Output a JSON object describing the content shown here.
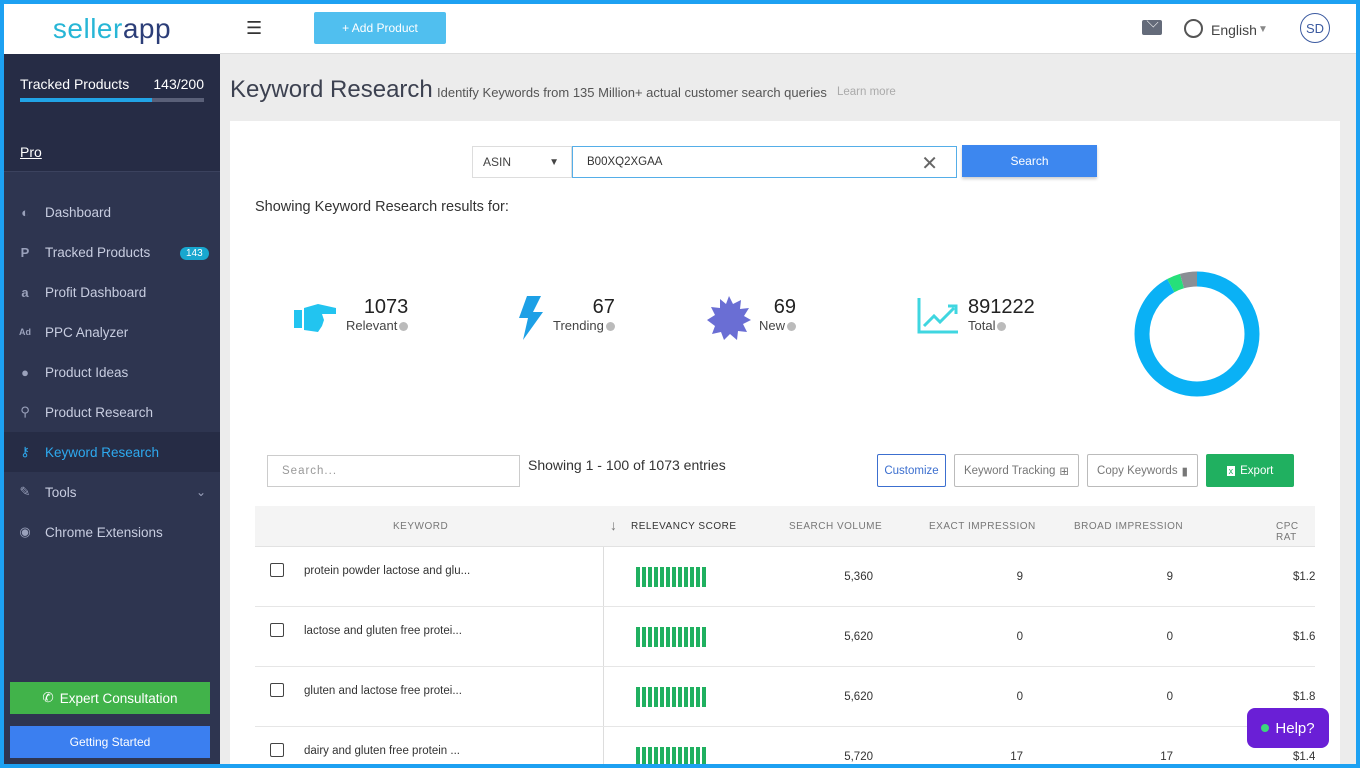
{
  "brand": {
    "part1": "seller",
    "part2": "app"
  },
  "sidebar": {
    "tracked_label": "Tracked Products",
    "tracked_count": "143/200",
    "tracked_fraction": 0.715,
    "plan": "Pro",
    "items": [
      {
        "label": "Dashboard",
        "icon": "speedometer-icon",
        "glyph": "◐"
      },
      {
        "label": "Tracked Products",
        "icon": "p-circle-icon",
        "glyph": "P",
        "badge": "143"
      },
      {
        "label": "Profit Dashboard",
        "icon": "amazon-icon",
        "glyph": "a"
      },
      {
        "label": "PPC Analyzer",
        "icon": "ad-icon",
        "glyph": "Ad"
      },
      {
        "label": "Product Ideas",
        "icon": "lightbulb-icon",
        "glyph": "●"
      },
      {
        "label": "Product Research",
        "icon": "search-icon",
        "glyph": "⚲"
      },
      {
        "label": "Keyword Research",
        "icon": "key-icon",
        "glyph": "⚷",
        "active": true
      },
      {
        "label": "Tools",
        "icon": "wrench-icon",
        "glyph": "✎"
      },
      {
        "label": "Chrome Extensions",
        "icon": "chrome-icon",
        "glyph": "◉"
      }
    ],
    "expert": "Expert Consultation",
    "getting_started": "Getting Started"
  },
  "topbar": {
    "add_product": "+ Add Product",
    "language": "English",
    "avatar": "SD"
  },
  "page": {
    "title": "Keyword Research",
    "subtitle": "Identify Keywords from 135 Million+ actual customer search queries",
    "learn_more": "Learn more",
    "search_type": "ASIN",
    "query": "B00XQ2XGAA",
    "search_button": "Search",
    "showing": "Showing Keyword Research results for:"
  },
  "stats": [
    {
      "value": "1073",
      "label": "Relevant",
      "icon": "pointing-hand-icon"
    },
    {
      "value": "67",
      "label": "Trending",
      "icon": "lightning-icon"
    },
    {
      "value": "69",
      "label": "New",
      "icon": "badge-star-icon"
    },
    {
      "value": "891222",
      "label": "Total",
      "icon": "trending-chart-icon"
    }
  ],
  "donut": {
    "segments": [
      {
        "value": 0.92,
        "color": "#0ab1f5"
      },
      {
        "value": 0.035,
        "color": "#26e07a"
      },
      {
        "value": 0.045,
        "color": "#8a8f95"
      }
    ]
  },
  "table": {
    "search_placeholder": "Search...",
    "entries": "Showing 1 - 100 of 1073 entries",
    "buttons": {
      "customize": "Customize",
      "keyword_tracking": "Keyword Tracking",
      "copy_keywords": "Copy Keywords",
      "export": "Export"
    },
    "headers": {
      "keyword": "KEYWORD",
      "relevancy": "RELEVANCY SCORE",
      "volume": "SEARCH VOLUME",
      "exact": "EXACT IMPRESSION",
      "broad": "BROAD IMPRESSION",
      "cpc": "CPC RAT"
    },
    "rows": [
      {
        "keyword": "protein powder lactose and glu...",
        "volume": "5,360",
        "exact": "9",
        "broad": "9",
        "cpc": "$1.2"
      },
      {
        "keyword": "lactose and gluten free protei...",
        "volume": "5,620",
        "exact": "0",
        "broad": "0",
        "cpc": "$1.6"
      },
      {
        "keyword": "gluten and lactose free protei...",
        "volume": "5,620",
        "exact": "0",
        "broad": "0",
        "cpc": "$1.8"
      },
      {
        "keyword": "dairy and gluten free protein ...",
        "volume": "5,720",
        "exact": "17",
        "broad": "17",
        "cpc": "$1.4"
      }
    ]
  },
  "help": "Help?"
}
